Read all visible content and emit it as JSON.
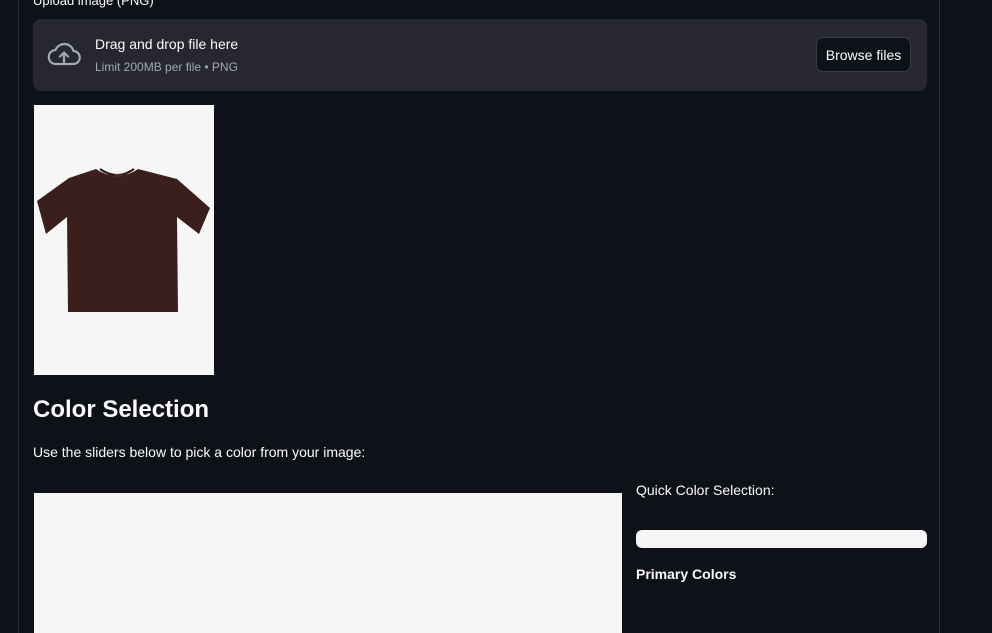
{
  "upload": {
    "label": "Upload image (PNG)",
    "drag_text": "Drag and drop file here",
    "limit_text": "Limit 200MB per file • PNG",
    "browse_label": "Browse files",
    "icon": "cloud-upload-icon"
  },
  "preview": {
    "icon": "tshirt-image",
    "shirt_color": "#3a1f1c",
    "background": "#f6f6f6"
  },
  "color_selection": {
    "title": "Color Selection",
    "description": "Use the sliders below to pick a color from your image:",
    "quick_label": "Quick Color Selection:",
    "primary_label": "Primary Colors"
  },
  "theme": {
    "background": "#0e1117",
    "panel": "#262730",
    "text": "#fafafa",
    "muted_text": "#a3a8b8"
  }
}
